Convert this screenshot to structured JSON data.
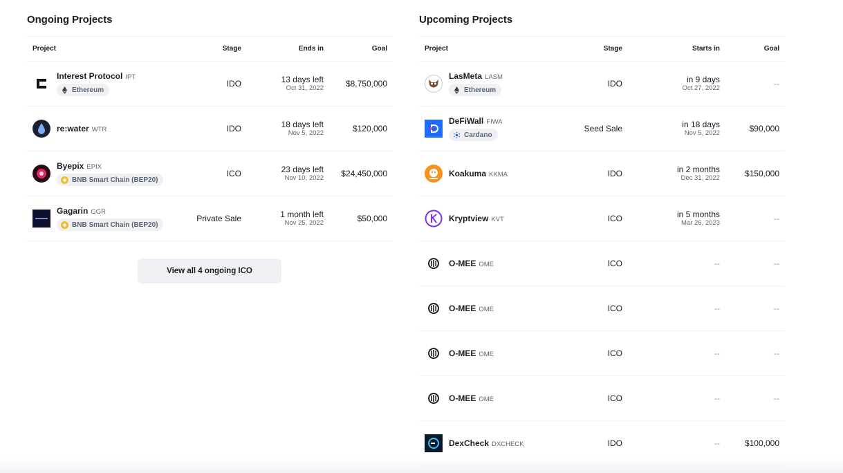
{
  "ongoing": {
    "title": "Ongoing Projects",
    "columns": {
      "project": "Project",
      "stage": "Stage",
      "ends": "Ends in",
      "goal": "Goal"
    },
    "rows": [
      {
        "name": "Interest Protocol",
        "ticker": "IPT",
        "chain": "Ethereum",
        "stage": "IDO",
        "time": "13 days left",
        "date": "Oct 31, 2022",
        "goal": "$8,750,000",
        "logo": "interest-protocol-logo",
        "chain_icon": "ethereum-icon"
      },
      {
        "name": "re:water",
        "ticker": "WTR",
        "chain": "",
        "stage": "IDO",
        "time": "18 days left",
        "date": "Nov 5, 2022",
        "goal": "$120,000",
        "logo": "rewater-logo",
        "chain_icon": ""
      },
      {
        "name": "Byepix",
        "ticker": "EPIX",
        "chain": "BNB Smart Chain (BEP20)",
        "stage": "ICO",
        "time": "23 days left",
        "date": "Nov 10, 2022",
        "goal": "$24,450,000",
        "logo": "byepix-logo",
        "chain_icon": "bnb-icon"
      },
      {
        "name": "Gagarin",
        "ticker": "GGR",
        "chain": "BNB Smart Chain (BEP20)",
        "stage": "Private Sale",
        "time": "1 month left",
        "date": "Nov 25, 2022",
        "goal": "$50,000",
        "logo": "gagarin-logo",
        "chain_icon": "bnb-icon"
      }
    ],
    "view_all_label": "View all 4 ongoing ICO"
  },
  "upcoming": {
    "title": "Upcoming Projects",
    "columns": {
      "project": "Project",
      "stage": "Stage",
      "starts": "Starts in",
      "goal": "Goal"
    },
    "rows": [
      {
        "name": "LasMeta",
        "ticker": "LASM",
        "chain": "Ethereum",
        "stage": "IDO",
        "time": "in 9 days",
        "date": "Oct 27, 2022",
        "goal": "--",
        "logo": "lasmeta-logo",
        "chain_icon": "ethereum-icon"
      },
      {
        "name": "DeFiWall",
        "ticker": "FIWA",
        "chain": "Cardano",
        "stage": "Seed Sale",
        "time": "in 18 days",
        "date": "Nov 5, 2022",
        "goal": "$90,000",
        "logo": "defiwall-logo",
        "chain_icon": "cardano-icon"
      },
      {
        "name": "Koakuma",
        "ticker": "KKMA",
        "chain": "",
        "stage": "IDO",
        "time": "in 2 months",
        "date": "Dec 31, 2022",
        "goal": "$150,000",
        "logo": "koakuma-logo",
        "chain_icon": ""
      },
      {
        "name": "Kryptview",
        "ticker": "KVT",
        "chain": "",
        "stage": "ICO",
        "time": "in 5 months",
        "date": "Mar 26, 2023",
        "goal": "--",
        "logo": "kryptview-logo",
        "chain_icon": ""
      },
      {
        "name": "O-MEE",
        "ticker": "OME",
        "chain": "",
        "stage": "ICO",
        "time": "--",
        "date": "",
        "goal": "--",
        "logo": "omee-logo",
        "chain_icon": ""
      },
      {
        "name": "O-MEE",
        "ticker": "OME",
        "chain": "",
        "stage": "ICO",
        "time": "--",
        "date": "",
        "goal": "--",
        "logo": "omee-logo",
        "chain_icon": ""
      },
      {
        "name": "O-MEE",
        "ticker": "OME",
        "chain": "",
        "stage": "ICO",
        "time": "--",
        "date": "",
        "goal": "--",
        "logo": "omee-logo",
        "chain_icon": ""
      },
      {
        "name": "O-MEE",
        "ticker": "OME",
        "chain": "",
        "stage": "ICO",
        "time": "--",
        "date": "",
        "goal": "--",
        "logo": "omee-logo",
        "chain_icon": ""
      },
      {
        "name": "DexCheck",
        "ticker": "DXCHECK",
        "chain": "",
        "stage": "IDO",
        "time": "--",
        "date": "",
        "goal": "$100,000",
        "logo": "dexcheck-logo",
        "chain_icon": ""
      }
    ]
  },
  "colors": {
    "text": "#1a1d24",
    "muted": "#5b6474",
    "dash": "#8a93a3",
    "border": "#eef0f3",
    "pill_bg": "#eef0f3",
    "bnb_yellow": "#f3ba2f",
    "defiwall_blue": "#1f6bff",
    "koakuma_orange": "#f7931a",
    "kryptview_purple": "#7b2ff7"
  }
}
